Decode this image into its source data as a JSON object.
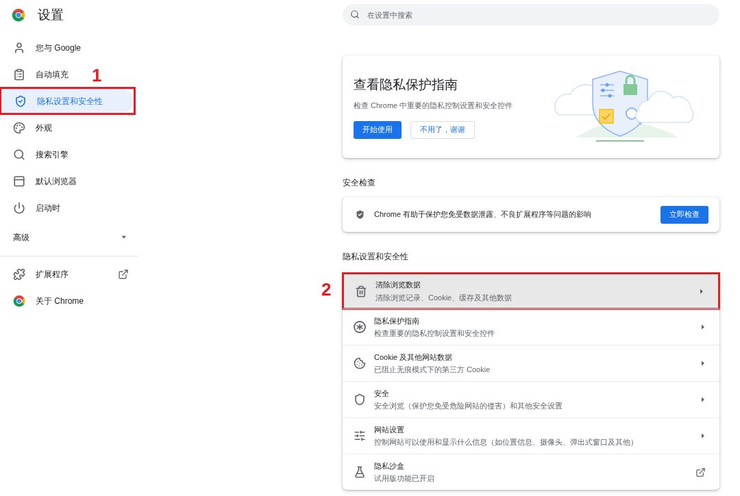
{
  "header": {
    "title": "设置"
  },
  "search": {
    "placeholder": "在设置中搜索"
  },
  "sidebar": {
    "items": [
      {
        "label": "您与 Google",
        "selected": false
      },
      {
        "label": "自动填充",
        "selected": false,
        "annotation": "1"
      },
      {
        "label": "隐私设置和安全性",
        "selected": true,
        "highlighted": true
      },
      {
        "label": "外观",
        "selected": false
      },
      {
        "label": "搜索引擎",
        "selected": false
      },
      {
        "label": "默认浏览器",
        "selected": false
      },
      {
        "label": "启动时",
        "selected": false
      }
    ],
    "advanced": {
      "label": "高级",
      "expanded": false
    },
    "links": [
      {
        "label": "扩展程序",
        "external": true
      },
      {
        "label": "关于 Chrome",
        "external": false
      }
    ]
  },
  "promo": {
    "title": "查看隐私保护指南",
    "text": "检查 Chrome 中重要的隐私控制设置和安全控件",
    "buttons": [
      {
        "label": "开始使用",
        "kind": "primary"
      },
      {
        "label": "不用了，谢谢",
        "kind": "secondary"
      }
    ]
  },
  "safety_check": {
    "heading": "安全检查",
    "text": "Chrome 有助于保护您免受数据泄露、不良扩展程序等问题的影响",
    "button": "立即检查"
  },
  "privacy": {
    "heading": "隐私设置和安全性",
    "rows": [
      {
        "title": "清除浏览数据",
        "subtitle": "清除浏览记录、Cookie、缓存及其他数据",
        "kind": "subpage",
        "highlighted": true,
        "annotation": "2"
      },
      {
        "title": "隐私保护指南",
        "subtitle": "检查重要的隐私控制设置和安全控件",
        "kind": "subpage",
        "highlighted": false
      },
      {
        "title": "Cookie 及其他网站数据",
        "subtitle": "已阻止无痕模式下的第三方 Cookie",
        "kind": "subpage",
        "highlighted": false
      },
      {
        "title": "安全",
        "subtitle": "安全浏览（保护您免受危险网站的侵害）和其他安全设置",
        "kind": "subpage",
        "highlighted": false
      },
      {
        "title": "网站设置",
        "subtitle": "控制网站可以使用和显示什么信息（如位置信息、摄像头、弹出式窗口及其他）",
        "kind": "subpage",
        "highlighted": false
      },
      {
        "title": "隐私沙盒",
        "subtitle": "试用版功能已开启",
        "kind": "external",
        "highlighted": false
      }
    ]
  }
}
